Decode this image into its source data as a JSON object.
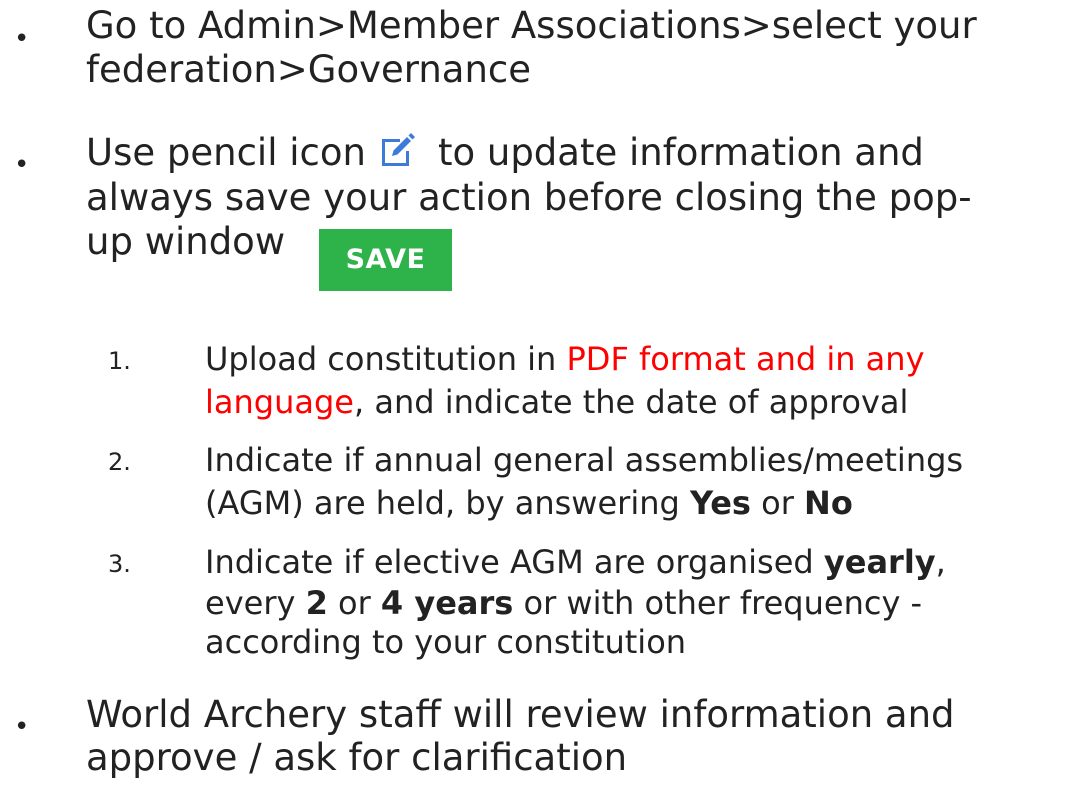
{
  "bullets": {
    "b1": {
      "line1": "Go to Admin>Member Associations>select your",
      "line2": "federation>Governance"
    },
    "b2": {
      "line1_before": "Use pencil icon",
      "line1_after": "to update information and",
      "line2": "always save your action before closing the pop-",
      "line3": "up window"
    },
    "b3": {
      "line1": "World Archery staff will review information and",
      "line2": "approve / ask for clarification"
    }
  },
  "save_button_label": "SAVE",
  "icons": {
    "pencil": "pencil-edit-icon"
  },
  "steps": [
    {
      "number": "1.",
      "line1_a": "Upload constitution in ",
      "line1_red": "PDF format and in any",
      "line2_red": "language",
      "line2_b": ", and indicate the date of approval"
    },
    {
      "number": "2.",
      "line1": "Indicate if annual general assemblies/meetings",
      "line2_a": "(AGM) are held, by answering ",
      "line2_yes": "Yes",
      "line2_or": " or ",
      "line2_no": "No"
    },
    {
      "number": "3.",
      "line1_a": "Indicate if elective AGM are organised ",
      "line1_yearly": "yearly",
      "line1_comma": ",",
      "line2_a": "every ",
      "line2_two": "2",
      "line2_or": " or ",
      "line2_four": "4 years",
      "line2_b": " or with other frequency -",
      "line3": "according to your constitution"
    }
  ],
  "colors": {
    "highlight_red": "#ff0000",
    "save_green": "#2db34a",
    "icon_blue": "#3d7bd9"
  }
}
